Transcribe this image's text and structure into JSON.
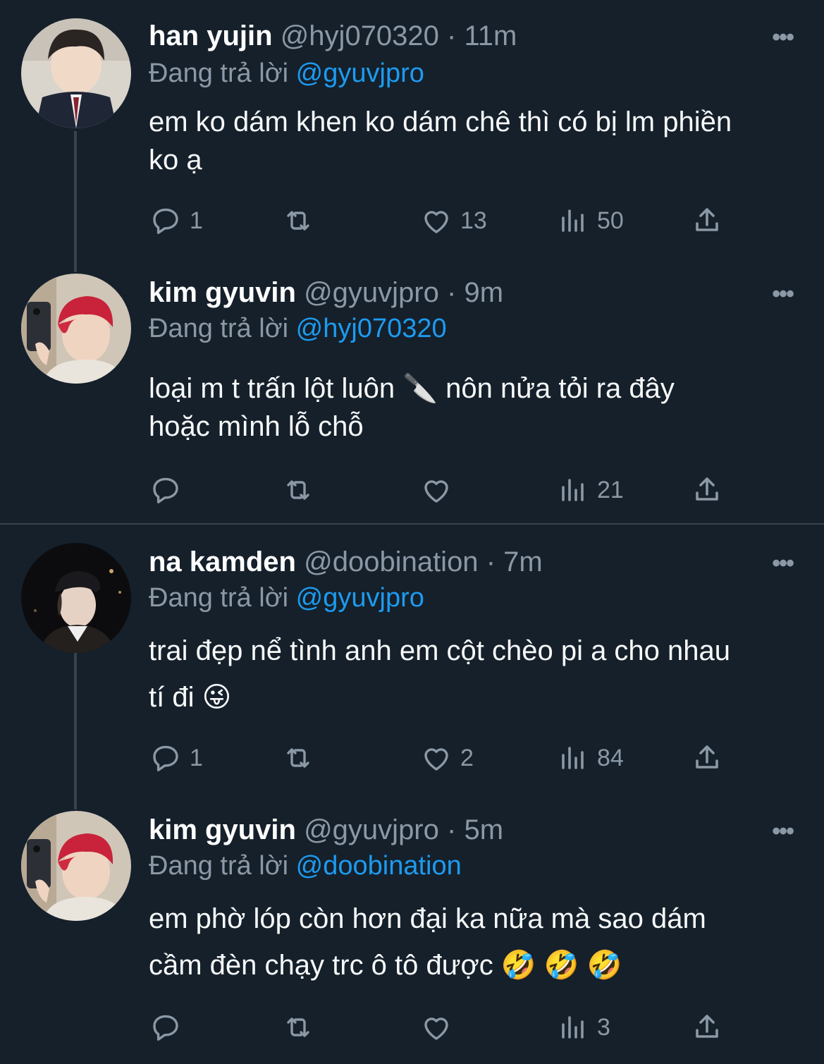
{
  "tweets": [
    {
      "name": "han yujin",
      "handle": "@hyj070320",
      "dot": "·",
      "time": "11m",
      "reply_prefix": "Đang trả lời",
      "reply_to": "@gyuvjpro",
      "text_lines": [
        "em ko dám khen ko dám chê thì có bị lm phiền",
        "ko ạ"
      ],
      "replies": "1",
      "retweets": "",
      "likes": "13",
      "views": "50"
    },
    {
      "name": "kim gyuvin",
      "handle": "@gyuvjpro",
      "dot": "·",
      "time": "9m",
      "reply_prefix": "Đang trả lời",
      "reply_to": "@hyj070320",
      "text_lines": [
        "loại m t trấn lột luôn 🔪  nôn nửa tỏi ra đây",
        "hoặc mình lỗ chỗ"
      ],
      "replies": "",
      "retweets": "",
      "likes": "",
      "views": "21"
    },
    {
      "name": "na kamden",
      "handle": "@doobination",
      "dot": "·",
      "time": "7m",
      "reply_prefix": "Đang trả lời",
      "reply_to": "@gyuvjpro",
      "text_lines": [
        "trai đẹp nể tình anh em cột chèo pi a cho nhau",
        "tí đi 😜"
      ],
      "replies": "1",
      "retweets": "",
      "likes": "2",
      "views": "84"
    },
    {
      "name": "kim gyuvin",
      "handle": "@gyuvjpro",
      "dot": "·",
      "time": "5m",
      "reply_prefix": "Đang trả lời",
      "reply_to": "@doobination",
      "text_lines": [
        "em phờ lóp còn hơn đại ka nữa mà sao dám",
        "cầm đèn chạy trc ô tô được 🤣 🤣 🤣"
      ],
      "replies": "",
      "retweets": "",
      "likes": "",
      "views": "3"
    }
  ],
  "more_glyph": "•••",
  "icons": [
    "reply-icon",
    "retweet-icon",
    "like-icon",
    "views-icon",
    "share-icon",
    "more-icon"
  ],
  "colors": {
    "background": "#15202b",
    "mention": "#1d9bf0",
    "muted": "#8b98a5",
    "line": "#38444d"
  }
}
